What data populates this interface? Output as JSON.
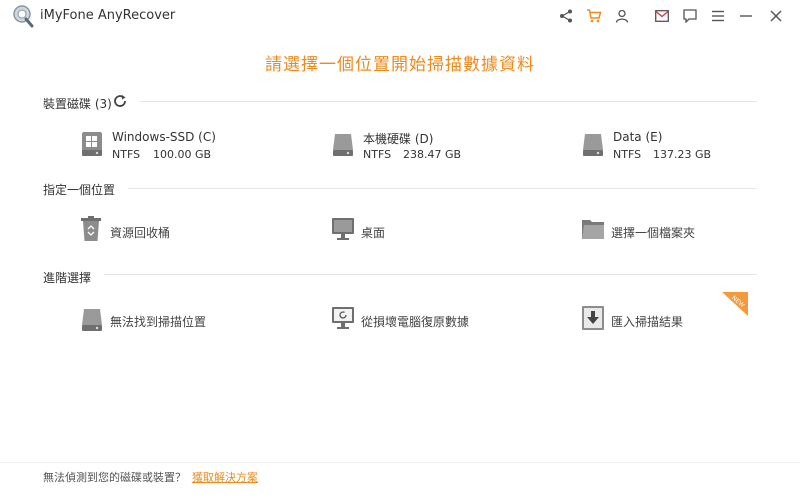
{
  "app": {
    "title": "iMyFone AnyRecover"
  },
  "headline": "請選擇一個位置開始掃描數據資料",
  "drives_section": {
    "title": "裝置磁碟 (3)"
  },
  "drives": [
    {
      "name": "Windows-SSD (C)",
      "fs": "NTFS",
      "size": "100.00 GB"
    },
    {
      "name": "本機硬碟 (D)",
      "fs": "NTFS",
      "size": "238.47 GB"
    },
    {
      "name": "Data (E)",
      "fs": "NTFS",
      "size": "137.23 GB"
    }
  ],
  "location_section": {
    "title": "指定一個位置"
  },
  "locations": [
    {
      "label": "資源回收桶"
    },
    {
      "label": "桌面"
    },
    {
      "label": "選擇一個檔案夾"
    }
  ],
  "advanced_section": {
    "title": "進階選擇"
  },
  "advanced": [
    {
      "label": "無法找到掃描位置"
    },
    {
      "label": "從損壞電腦復原數據"
    },
    {
      "label": "匯入掃描結果"
    }
  ],
  "badge": {
    "text": "NEW"
  },
  "footer": {
    "text": "無法偵測到您的磁碟或裝置？",
    "link": "獲取解決方案"
  },
  "colors": {
    "accent": "#f08a1c",
    "text": "#333333",
    "line": "#e6e6e6"
  }
}
